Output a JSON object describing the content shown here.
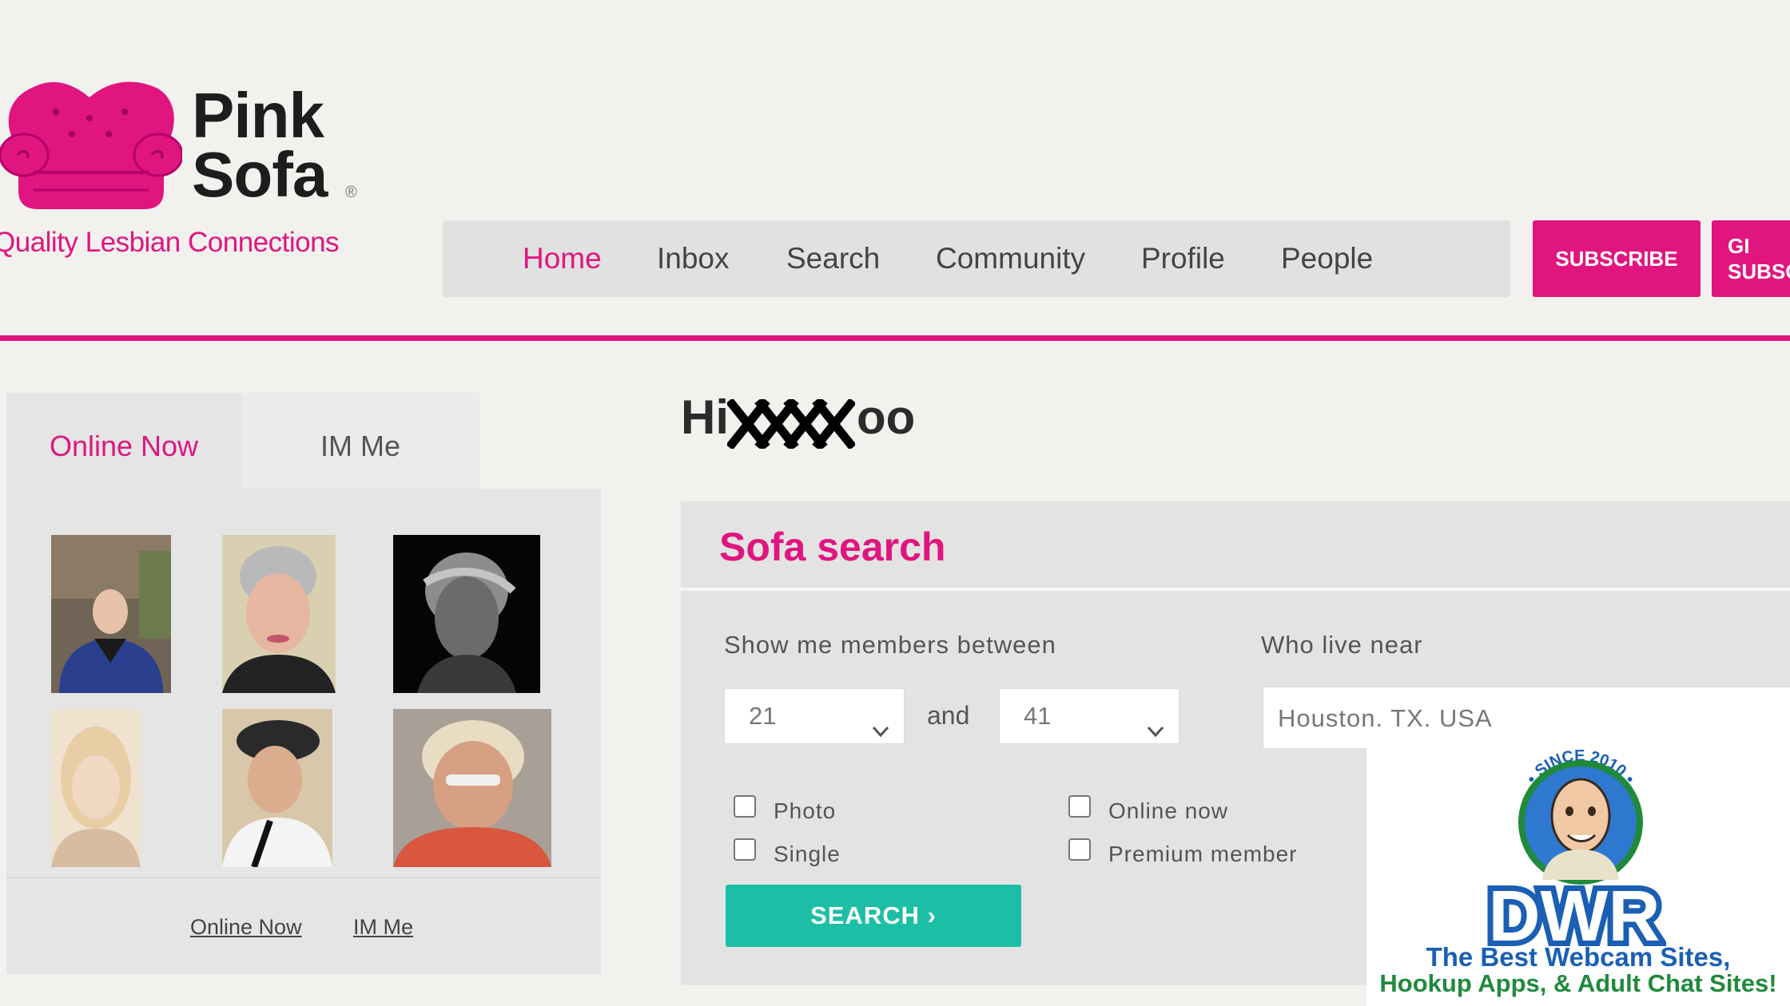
{
  "brand": {
    "name_line1": "Pink",
    "name_line2": "Sofa",
    "registered": "®",
    "tagline": "Quality Lesbian Connections"
  },
  "nav": {
    "items": [
      {
        "label": "Home",
        "active": true
      },
      {
        "label": "Inbox",
        "active": false
      },
      {
        "label": "Search",
        "active": false
      },
      {
        "label": "Community",
        "active": false
      },
      {
        "label": "Profile",
        "active": false
      },
      {
        "label": "People",
        "active": false
      }
    ],
    "subscribe_label": "SUBSCRIBE",
    "gift_label_line1": "GI",
    "gift_label_line2": "SUBSCI"
  },
  "left_panel": {
    "tabs": [
      {
        "label": "Online Now",
        "active": true
      },
      {
        "label": "IM Me",
        "active": false
      }
    ],
    "member_count": 6,
    "footer_links": [
      "Online Now",
      "IM Me"
    ]
  },
  "greeting": {
    "prefix": "Hi",
    "suffix": "oo"
  },
  "search": {
    "title": "Sofa search",
    "age_label": "Show me members between",
    "age_min": "21",
    "and_label": "and",
    "age_max": "41",
    "location_label": "Who live near",
    "location_value": "Houston, TX, USA",
    "checkboxes": [
      {
        "label": "Photo",
        "checked": false
      },
      {
        "label": "Online now",
        "checked": false
      },
      {
        "label": "Single",
        "checked": false
      },
      {
        "label": "Premium member",
        "checked": false
      }
    ],
    "button_label": "SEARCH ›"
  },
  "ad": {
    "since_text": "• SINCE 2010 •",
    "logo": "DWR",
    "line1": "The Best Webcam Sites,",
    "line2": "Hookup Apps, & Adult Chat Sites!"
  },
  "colors": {
    "brand_pink": "#e0157f",
    "search_teal": "#1cbfa5",
    "ad_blue": "#1a5fb4",
    "ad_green": "#1f8a3b"
  }
}
